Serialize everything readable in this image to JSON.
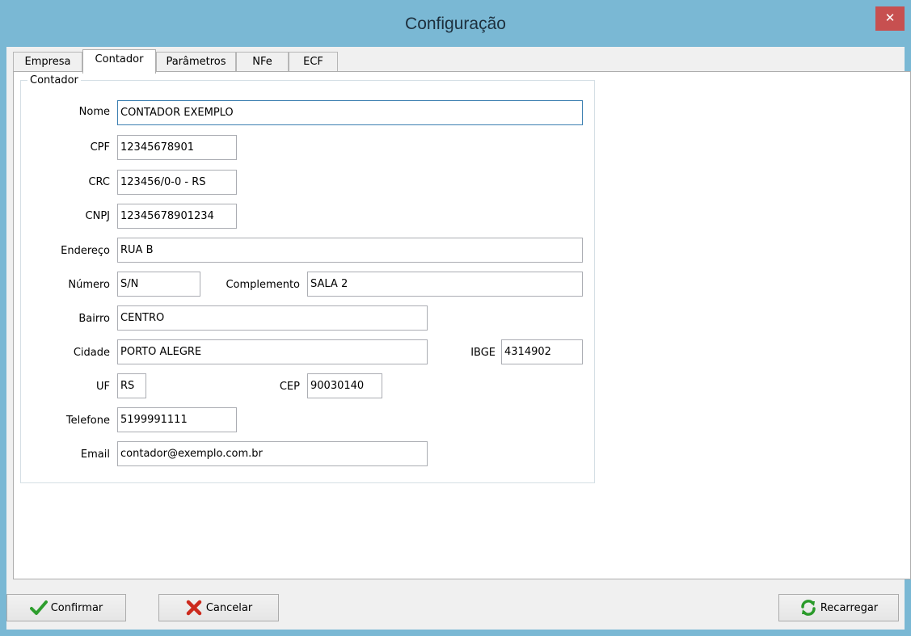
{
  "window": {
    "title": "Configuração",
    "close_glyph": "✕"
  },
  "tabs": [
    {
      "label": "Empresa",
      "active": false
    },
    {
      "label": "Contador",
      "active": true
    },
    {
      "label": "Parâmetros",
      "active": false
    },
    {
      "label": "NFe",
      "active": false
    },
    {
      "label": "ECF",
      "active": false
    }
  ],
  "group": {
    "title": "Contador"
  },
  "form": {
    "nome": {
      "label": "Nome",
      "value": "CONTADOR EXEMPLO"
    },
    "cpf": {
      "label": "CPF",
      "value": "12345678901"
    },
    "crc": {
      "label": "CRC",
      "value": "123456/0-0 - RS"
    },
    "cnpj": {
      "label": "CNPJ",
      "value": "12345678901234"
    },
    "endereco": {
      "label": "Endereço",
      "value": "RUA B"
    },
    "numero": {
      "label": "Número",
      "value": "S/N"
    },
    "complemento": {
      "label": "Complemento",
      "value": "SALA 2"
    },
    "bairro": {
      "label": "Bairro",
      "value": "CENTRO"
    },
    "cidade": {
      "label": "Cidade",
      "value": "PORTO ALEGRE"
    },
    "ibge": {
      "label": "IBGE",
      "value": "4314902"
    },
    "uf": {
      "label": "UF",
      "value": "RS"
    },
    "cep": {
      "label": "CEP",
      "value": "90030140"
    },
    "telefone": {
      "label": "Telefone",
      "value": "5199991111"
    },
    "email": {
      "label": "Email",
      "value": "contador@exemplo.com.br"
    }
  },
  "buttons": {
    "confirmar": {
      "label": "Confirmar",
      "icon": "checkmark-icon"
    },
    "cancelar": {
      "label": "Cancelar",
      "icon": "x-icon"
    },
    "recarregar": {
      "label": "Recarregar",
      "icon": "refresh-icon"
    }
  },
  "colors": {
    "titlebar": "#7ab8d4",
    "close_button": "#c75050",
    "confirm_check": "#2e9e2e",
    "cancel_x": "#cc2a1d",
    "refresh": "#2a9a2a"
  }
}
